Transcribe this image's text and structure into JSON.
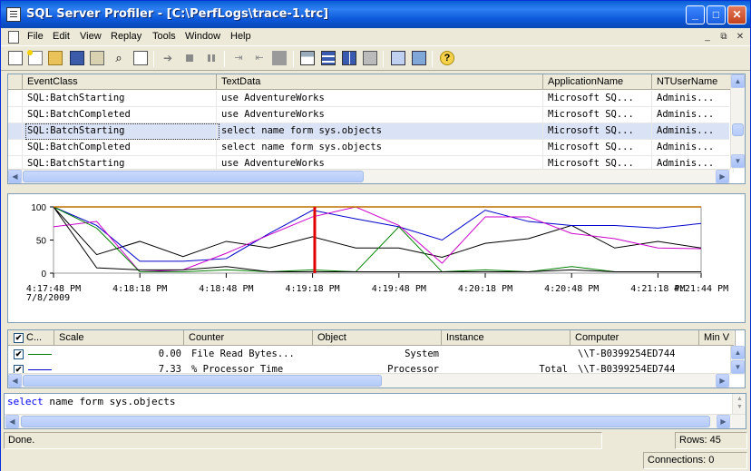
{
  "window": {
    "title": "SQL Server Profiler - [C:\\PerfLogs\\trace-1.trc]",
    "controls": {
      "minimize": "_",
      "maximize": "□",
      "close": "✕"
    }
  },
  "menu": [
    "File",
    "Edit",
    "View",
    "Replay",
    "Tools",
    "Window",
    "Help"
  ],
  "mdi_controls": [
    "_",
    "⧉",
    "✕"
  ],
  "toolbar_icons": [
    "new-trace-icon",
    "new-file-icon",
    "open-icon",
    "save-icon",
    "properties-icon",
    "find-icon",
    "clear-icon",
    "run-icon",
    "stop-icon",
    "pause-icon",
    "step-icon",
    "step-to-cursor-icon",
    "breakpoint-icon",
    "tile-icon",
    "horizontal-icon",
    "vertical-icon",
    "autoscroll-icon",
    "db-tuning-icon",
    "perfmon-icon",
    "help-icon"
  ],
  "trace_grid": {
    "columns": [
      "EventClass",
      "TextData",
      "ApplicationName",
      "NTUserName"
    ],
    "rows": [
      [
        "SQL:BatchStarting",
        "use AdventureWorks",
        "Microsoft SQ...",
        "Adminis..."
      ],
      [
        "SQL:BatchCompleted",
        "use AdventureWorks",
        "Microsoft SQ...",
        "Adminis..."
      ],
      [
        "SQL:BatchStarting",
        "select name form sys.objects",
        "Microsoft SQ...",
        "Adminis..."
      ],
      [
        "SQL:BatchCompleted",
        "select name form sys.objects",
        "Microsoft SQ...",
        "Adminis..."
      ],
      [
        "SQL:BatchStarting",
        "use AdventureWorks",
        "Microsoft SQ...",
        "Adminis..."
      ]
    ],
    "selected_row": 2
  },
  "chart_data": {
    "type": "line",
    "ylim": [
      0,
      100
    ],
    "yticks": [
      "100",
      "50",
      "0"
    ],
    "xticks": [
      "4:17:48 PM",
      "4:18:18 PM",
      "4:18:48 PM",
      "4:19:18 PM",
      "4:19:48 PM",
      "4:20:18 PM",
      "4:20:48 PM",
      "4:21:18 PM",
      "4:21:44 PM"
    ],
    "date_label": "7/8/2009",
    "x": [
      0,
      1,
      2,
      3,
      4,
      5,
      6,
      7,
      8,
      9,
      10,
      11,
      12,
      13,
      14,
      15
    ],
    "cursor_x": 6.05,
    "series": [
      {
        "color": "#000000",
        "values": [
          100,
          28,
          48,
          25,
          48,
          38,
          55,
          38,
          38,
          24,
          45,
          52,
          72,
          38,
          48,
          38
        ]
      },
      {
        "color": "#0000cc",
        "values": [
          100,
          72,
          18,
          18,
          22,
          60,
          95,
          82,
          70,
          50,
          95,
          78,
          72,
          72,
          68,
          75
        ]
      },
      {
        "color": "#cc00cc",
        "values": [
          70,
          78,
          2,
          5,
          30,
          58,
          85,
          100,
          72,
          15,
          85,
          85,
          60,
          52,
          38,
          37
        ]
      },
      {
        "color": "#008000",
        "values": [
          100,
          68,
          2,
          2,
          5,
          2,
          5,
          2,
          70,
          2,
          5,
          2,
          10,
          2,
          2,
          2
        ]
      },
      {
        "color": "#000000",
        "values": [
          100,
          8,
          5,
          5,
          10,
          2,
          2,
          2,
          2,
          2,
          2,
          2,
          5,
          2,
          2,
          2
        ]
      },
      {
        "color": "#c07000",
        "values": [
          100,
          100,
          100,
          100,
          100,
          100,
          100,
          100,
          100,
          100,
          100,
          100,
          100,
          100,
          100,
          100
        ]
      }
    ]
  },
  "counter_grid": {
    "columns": [
      "C...",
      "Scale",
      "Counter",
      "Object",
      "Instance",
      "Computer",
      "Min V"
    ],
    "rows": [
      {
        "checked": "✔",
        "color": "#008000",
        "scale": "0.00",
        "counter": "File Read Bytes...",
        "object": "System",
        "instance": "",
        "computer": "\\\\T-B0399254ED744"
      },
      {
        "checked": "✔",
        "color": "#0000cc",
        "scale": "7.33",
        "counter": "% Processor Time",
        "object": "Processor",
        "instance": "_Total",
        "computer": "\\\\T-B0399254ED744"
      }
    ]
  },
  "sql_text": {
    "keyword": "select",
    "rest": " name form sys.objects"
  },
  "status": {
    "message": "Done.",
    "rows": "Rows: 45",
    "connections": "Connections: 0"
  }
}
